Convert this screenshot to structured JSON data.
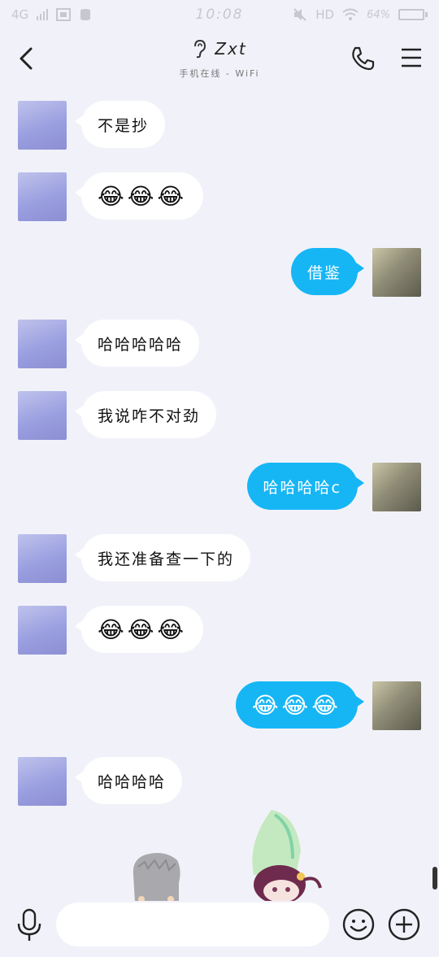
{
  "status_bar": {
    "network": "4G",
    "time": "10:08",
    "hd": "HD",
    "battery": "64%",
    "battery_fraction": 0.64
  },
  "header": {
    "contact_name": "Zxt",
    "contact_status": "手机在线 - WiFi",
    "icons": [
      "back-icon",
      "ear-icon",
      "phone-icon",
      "menu-icon"
    ]
  },
  "messages": [
    {
      "side": "them",
      "text": "不是抄"
    },
    {
      "side": "them",
      "text": "😂😂😂"
    },
    {
      "side": "me",
      "text": "借鉴"
    },
    {
      "side": "them",
      "text": "哈哈哈哈哈"
    },
    {
      "side": "them",
      "text": "我说咋不对劲"
    },
    {
      "side": "me",
      "text": "哈哈哈哈c"
    },
    {
      "side": "them",
      "text": "我还准备查一下的"
    },
    {
      "side": "them",
      "text": "😂😂😂"
    },
    {
      "side": "me",
      "text": "😂😂😂"
    },
    {
      "side": "them",
      "text": "哈哈哈哈"
    }
  ],
  "input_bar": {
    "value": "",
    "placeholder": "",
    "icons": [
      "microphone-icon",
      "smiley-icon",
      "plus-icon"
    ]
  },
  "colors": {
    "background": "#f1f2f9",
    "my_bubble": "#16b6f5",
    "their_bubble": "#ffffff"
  }
}
